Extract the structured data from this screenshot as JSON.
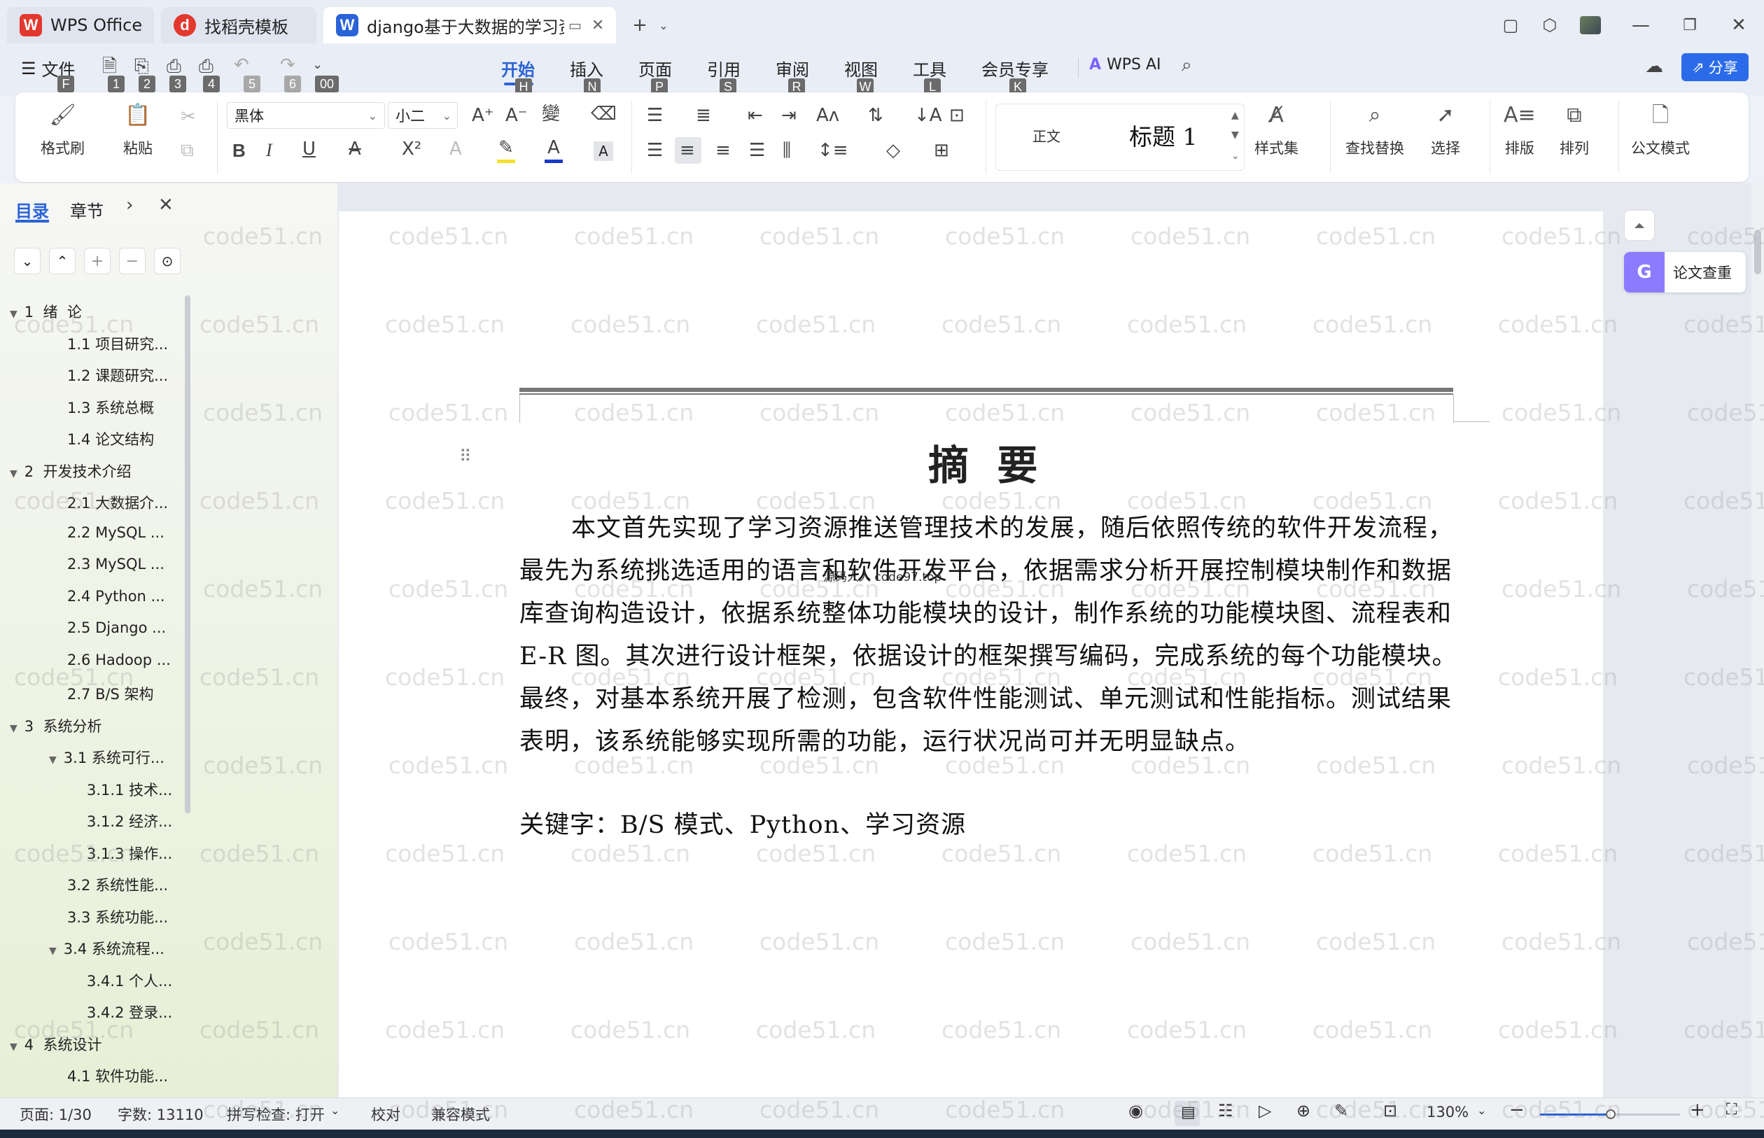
{
  "titlebar": {
    "tabs": [
      {
        "label": "WPS Office",
        "icon": "wps-logo-icon"
      },
      {
        "label": "找稻壳模板",
        "icon": "docer-icon"
      },
      {
        "label": "django基于大数据的学习资源",
        "icon": "word-doc-icon"
      }
    ]
  },
  "menu": {
    "file_label": "文件",
    "wps_ai": "WPS AI",
    "share": "分享",
    "tabs": [
      "开始",
      "插入",
      "页面",
      "引用",
      "审阅",
      "视图",
      "工具",
      "会员专享"
    ],
    "tab_keys": [
      "H",
      "N",
      "P",
      "S",
      "R",
      "W",
      "L",
      "K"
    ],
    "quick_keys": [
      "F",
      "1",
      "2",
      "3",
      "4",
      "5",
      "6",
      "00"
    ]
  },
  "ribbon": {
    "format_painter": "格式刷",
    "paste": "粘贴",
    "font_name": "黑体",
    "font_size": "小二",
    "style_normal": "正文",
    "style_heading": "标题 1",
    "style_set": "样式集",
    "find_replace": "查找替换",
    "select": "选择",
    "typeset": "排版",
    "arrange": "排列",
    "official_mode": "公文模式"
  },
  "sidebar": {
    "tab_toc": "目录",
    "tab_chapter": "章节",
    "items": [
      {
        "label": "1  绪  论",
        "level": 1,
        "expanded": true
      },
      {
        "label": "1.1 项目研究...",
        "level": 2
      },
      {
        "label": "1.2 课题研究...",
        "level": 2
      },
      {
        "label": "1.3 系统总概",
        "level": 2
      },
      {
        "label": "1.4 论文结构",
        "level": 2
      },
      {
        "label": "2  开发技术介绍",
        "level": 1,
        "expanded": true
      },
      {
        "label": "2.1 大数据介...",
        "level": 2
      },
      {
        "label": "2.2 MySQL ...",
        "level": 2
      },
      {
        "label": "2.3 MySQL ...",
        "level": 2
      },
      {
        "label": "2.4 Python ...",
        "level": 2
      },
      {
        "label": "2.5 Django ...",
        "level": 2
      },
      {
        "label": "2.6 Hadoop ...",
        "level": 2
      },
      {
        "label": "2.7 B/S 架构",
        "level": 2
      },
      {
        "label": "3  系统分析",
        "level": 1,
        "expanded": true
      },
      {
        "label": "3.1 系统可行...",
        "level": 2,
        "expanded": true
      },
      {
        "label": "3.1.1 技术...",
        "level": 3
      },
      {
        "label": "3.1.2 经济...",
        "level": 3
      },
      {
        "label": "3.1.3 操作...",
        "level": 3
      },
      {
        "label": "3.2 系统性能...",
        "level": 2
      },
      {
        "label": "3.3 系统功能...",
        "level": 2
      },
      {
        "label": "3.4 系统流程...",
        "level": 2,
        "expanded": true
      },
      {
        "label": "3.4.1 个人...",
        "level": 3
      },
      {
        "label": "3.4.2 登录...",
        "level": 3
      },
      {
        "label": "4  系统设计",
        "level": 1,
        "expanded": true
      },
      {
        "label": "4.1 软件功能...",
        "level": 2
      }
    ]
  },
  "document": {
    "title": "摘  要",
    "inline_mark": "源码人人 code97.top",
    "lines": [
      "本文首先实现了学习资源推送管理技术的发展，随后依照传统的软件开发流程，",
      "最先为系统挑选适用的语言和软件开发平台，依据需求分析开展控制模块制作和数据",
      "库查询构造设计，依据系统整体功能模块的设计，制作系统的功能模块图、流程表和",
      "E-R 图。其次进行设计框架，依据设计的框架撰写编码，完成系统的每个功能模块。",
      "最终，对基本系统开展了检测，包含软件性能测试、单元测试和性能指标。测试结果",
      "表明，该系统能够实现所需的功能，运行状况尚可并无明显缺点。"
    ],
    "keywords": "关键字：B/S 模式、Python、学习资源",
    "watermark": "code51.cn"
  },
  "right_panel": {
    "paper_check": "论文查重"
  },
  "status": {
    "page": "页面: 1/30",
    "words": "字数: 13110",
    "spell": "拼写检查: 打开",
    "proof": "校对",
    "compat": "兼容模式",
    "zoom": "130%"
  },
  "colors": {
    "accent": "#2a63d8",
    "wps_red": "#e3382d",
    "share_bg": "#2b6bea",
    "ai_purple": "#7b61ff"
  }
}
